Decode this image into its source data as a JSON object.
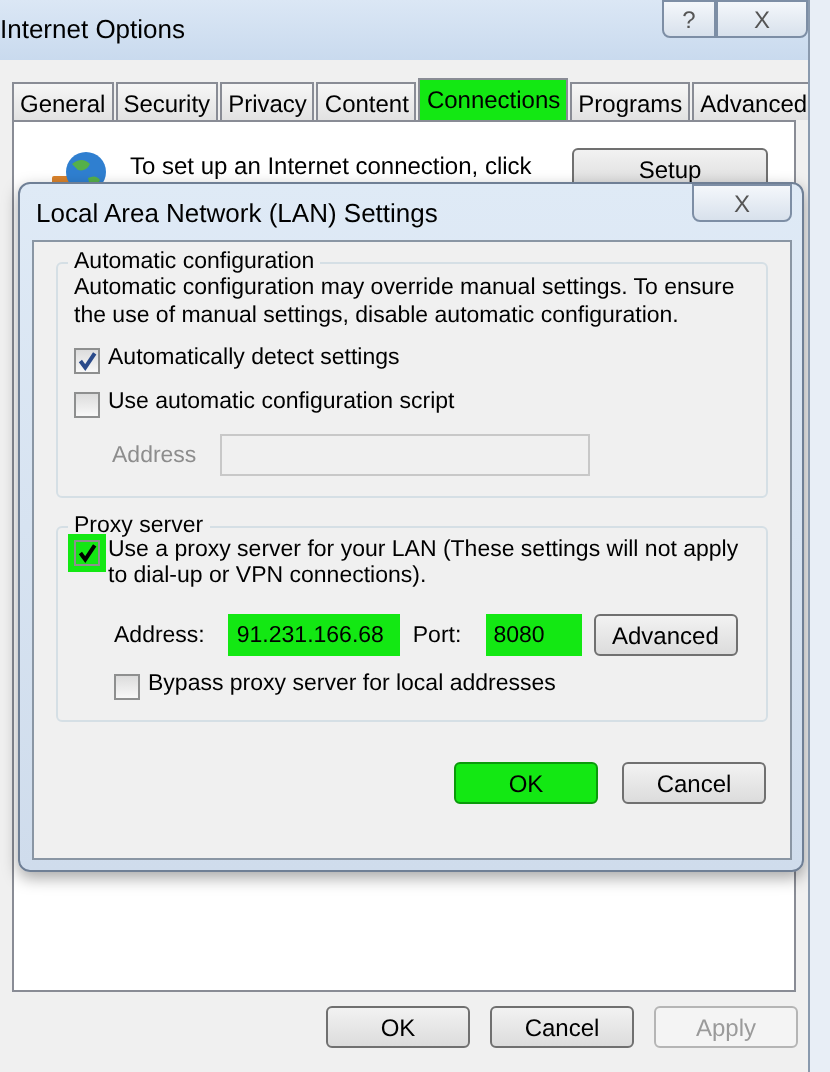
{
  "window": {
    "title": "Internet Options",
    "help": "?",
    "close": "X"
  },
  "tabs": [
    {
      "label": "General",
      "selected": false,
      "highlighted": false
    },
    {
      "label": "Security",
      "selected": false,
      "highlighted": false
    },
    {
      "label": "Privacy",
      "selected": false,
      "highlighted": false
    },
    {
      "label": "Content",
      "selected": false,
      "highlighted": false
    },
    {
      "label": "Connections",
      "selected": true,
      "highlighted": true
    },
    {
      "label": "Programs",
      "selected": false,
      "highlighted": false
    },
    {
      "label": "Advanced",
      "selected": false,
      "highlighted": false
    }
  ],
  "connections": {
    "intro": "To set up an Internet connection, click",
    "setup_button": "Setup"
  },
  "buttons": [
    {
      "label": "OK",
      "disabled": false
    },
    {
      "label": "Cancel",
      "disabled": false
    },
    {
      "label": "Apply",
      "disabled": true
    }
  ],
  "lan_dialog": {
    "title": "Local Area Network (LAN) Settings",
    "close": "X",
    "automatic": {
      "title": "Automatic configuration",
      "description": "Automatic configuration may override manual settings.  To ensure the use of manual settings, disable automatic configuration.",
      "options": [
        {
          "label": "Automatically detect settings",
          "checked": true
        },
        {
          "label": "Use automatic configuration script",
          "checked": false
        }
      ],
      "address": {
        "label": "Address",
        "disabled": true
      }
    },
    "proxy": {
      "title": "Proxy server",
      "use_proxy": {
        "label": "Use a proxy server for your LAN (These settings will not apply to dial-up or VPN connections).",
        "checked": true,
        "highlighted": true
      },
      "address": {
        "label": "Address:",
        "value": "91.231.166.68",
        "highlighted": true
      },
      "port": {
        "label": "Port:",
        "value": "8080",
        "highlighted": true
      },
      "advanced_button": "Advanced",
      "bypass": {
        "label": "Bypass proxy server for local addresses",
        "checked": false
      }
    },
    "buttons": [
      {
        "label": "OK",
        "highlighted": true
      },
      {
        "label": "Cancel",
        "highlighted": false
      }
    ]
  }
}
